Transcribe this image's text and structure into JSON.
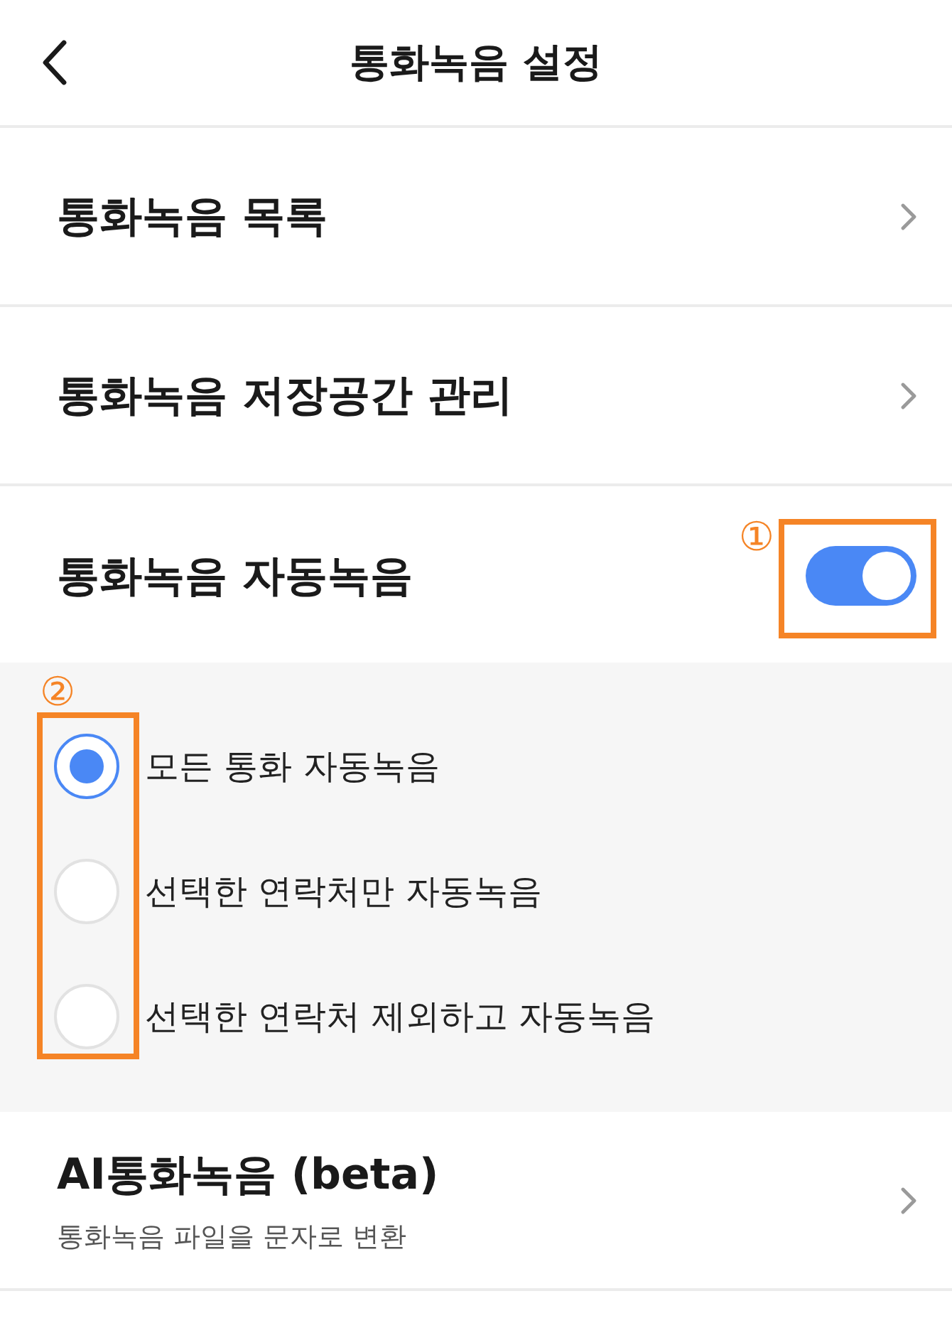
{
  "header": {
    "title": "통화녹음 설정"
  },
  "items": [
    {
      "kind": "link",
      "title": "통화녹음 목록"
    },
    {
      "kind": "link",
      "title": "통화녹음 저장공간 관리"
    },
    {
      "kind": "toggle",
      "title": "통화녹음 자동녹음",
      "on": true,
      "callout": "①"
    },
    {
      "kind": "radio_group",
      "callout": "②",
      "options": [
        {
          "label": "모든 통화 자동녹음",
          "selected": true
        },
        {
          "label": "선택한 연락처만 자동녹음",
          "selected": false
        },
        {
          "label": "선택한 연락처 제외하고 자동녹음",
          "selected": false
        }
      ]
    },
    {
      "kind": "link",
      "title": "AI통화녹음 (beta)",
      "subtitle": "통화녹음 파일을 문자로 변환"
    }
  ]
}
